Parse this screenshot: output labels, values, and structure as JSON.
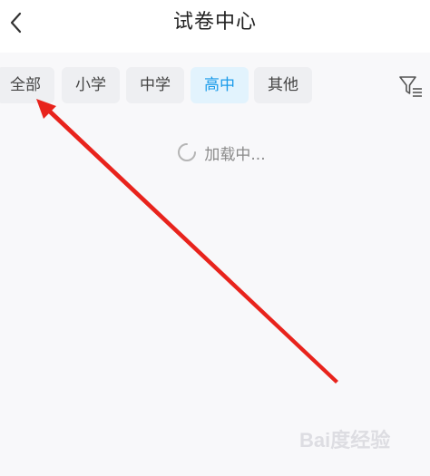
{
  "header": {
    "title": "试卷中心"
  },
  "filters": {
    "tabs": [
      "全部",
      "小学",
      "中学",
      "高中",
      "其他"
    ],
    "active_index": 3
  },
  "loading": {
    "text": "加载中..."
  },
  "watermark": {
    "text": "Bai度经验"
  },
  "colors": {
    "accent": "#1a9bea",
    "annotation_arrow": "#e8231c"
  }
}
